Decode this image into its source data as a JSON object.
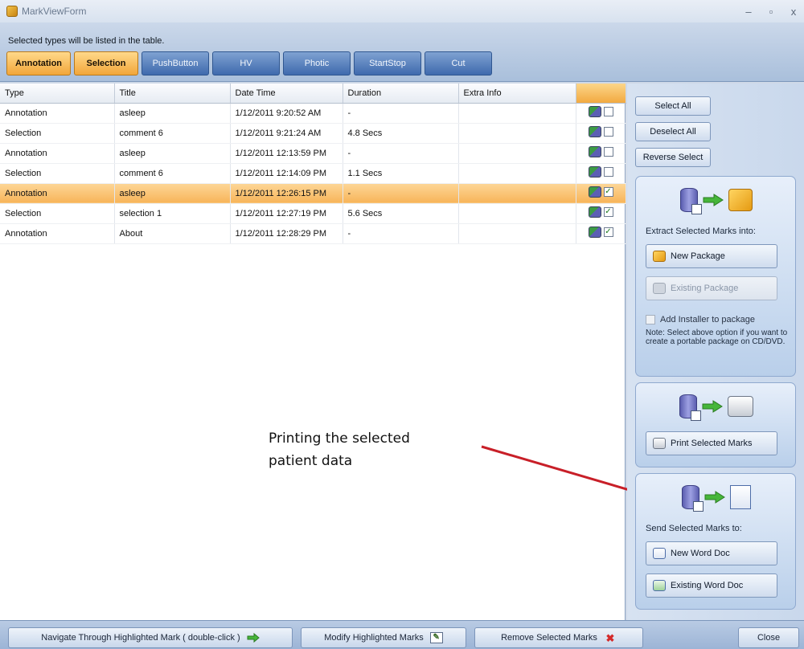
{
  "window": {
    "title": "MarkViewForm",
    "controls": [
      "–",
      "▫",
      "x"
    ]
  },
  "filter": {
    "hint": "Selected types will be listed in the table.",
    "tabs": [
      {
        "label": "Annotation",
        "active": true
      },
      {
        "label": "Selection",
        "active": true
      },
      {
        "label": "PushButton",
        "active": false
      },
      {
        "label": "HV",
        "active": false
      },
      {
        "label": "Photic",
        "active": false
      },
      {
        "label": "StartStop",
        "active": false
      },
      {
        "label": "Cut",
        "active": false
      }
    ]
  },
  "table": {
    "columns": [
      "Type",
      "Title",
      "Date Time",
      "Duration",
      "Extra Info"
    ],
    "rows": [
      {
        "type": "Annotation",
        "title": "asleep",
        "datetime": "1/12/2011 9:20:52 AM",
        "duration": "-",
        "extra": "",
        "checked": false,
        "highlighted": false
      },
      {
        "type": "Selection",
        "title": "comment 6",
        "datetime": "1/12/2011 9:21:24 AM",
        "duration": "4.8 Secs",
        "extra": "",
        "checked": false,
        "highlighted": false
      },
      {
        "type": "Annotation",
        "title": "asleep",
        "datetime": "1/12/2011 12:13:59 PM",
        "duration": "-",
        "extra": "",
        "checked": false,
        "highlighted": false
      },
      {
        "type": "Selection",
        "title": "comment 6",
        "datetime": "1/12/2011 12:14:09 PM",
        "duration": "1.1 Secs",
        "extra": "",
        "checked": false,
        "highlighted": false
      },
      {
        "type": "Annotation",
        "title": "asleep",
        "datetime": "1/12/2011 12:26:15 PM",
        "duration": "-",
        "extra": "",
        "checked": true,
        "highlighted": true
      },
      {
        "type": "Selection",
        "title": "selection 1",
        "datetime": "1/12/2011 12:27:19 PM",
        "duration": "5.6 Secs",
        "extra": "",
        "checked": true,
        "highlighted": false
      },
      {
        "type": "Annotation",
        "title": "About",
        "datetime": "1/12/2011 12:28:29 PM",
        "duration": "-",
        "extra": "",
        "checked": true,
        "highlighted": false
      }
    ]
  },
  "annotation": {
    "line1": "Printing the selected",
    "line2": "patient data",
    "arrow_color": "#c81f28"
  },
  "right_panel": {
    "select_all": "Select All",
    "deselect_all": "Deselect All",
    "reverse_select": "Reverse Select",
    "extract": {
      "heading": "Extract Selected Marks into:",
      "new_package": "New Package",
      "existing_package": "Existing Package",
      "add_installer": "Add Installer to package",
      "note": "Note: Select above option if you want to create a portable package on CD/DVD."
    },
    "print": {
      "button": "Print Selected Marks"
    },
    "send": {
      "heading": "Send Selected Marks to:",
      "new_word": "New Word Doc",
      "existing_word": "Existing Word Doc"
    }
  },
  "bottom": {
    "navigate": "Navigate Through Highlighted Mark ( double-click )",
    "modify": "Modify Highlighted Marks",
    "remove": "Remove Selected Marks",
    "close": "Close"
  },
  "colors": {
    "accent_orange": "#f2a63a",
    "tab_blue": "#3f6aad",
    "remove_red": "#d42a2a",
    "go_green": "#46b63a"
  }
}
